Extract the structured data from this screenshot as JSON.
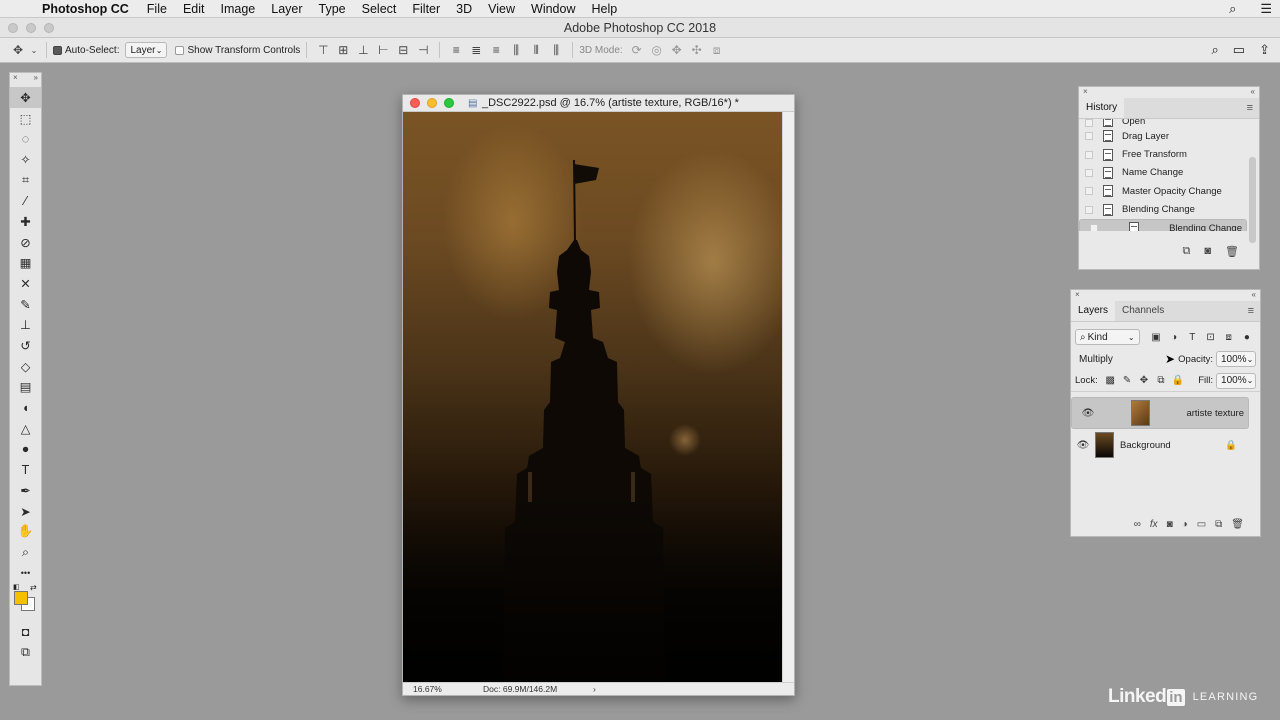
{
  "menubar": {
    "apple": "",
    "app_name": "Photoshop CC",
    "items": [
      "File",
      "Edit",
      "Image",
      "Layer",
      "Type",
      "Select",
      "Filter",
      "3D",
      "View",
      "Window",
      "Help"
    ]
  },
  "window_title": "Adobe Photoshop CC 2018",
  "options_bar": {
    "auto_select_label": "Auto-Select:",
    "auto_select_value": "Layer",
    "transform_label": "Show Transform Controls",
    "mode_label": "3D Mode:"
  },
  "tools": [
    {
      "name": "move-tool",
      "glyph": "✥"
    },
    {
      "name": "marquee-tool",
      "glyph": "⬚"
    },
    {
      "name": "lasso-tool",
      "glyph": "◌"
    },
    {
      "name": "magic-wand-tool",
      "glyph": "✧"
    },
    {
      "name": "crop-tool",
      "glyph": "⌗"
    },
    {
      "name": "eyedropper-tool",
      "glyph": "⁄"
    },
    {
      "name": "spot-healing-tool",
      "glyph": "✚"
    },
    {
      "name": "healing-tool",
      "glyph": "⊘"
    },
    {
      "name": "patch-tool",
      "glyph": "▦"
    },
    {
      "name": "content-aware-move-tool",
      "glyph": "✕"
    },
    {
      "name": "brush-tool",
      "glyph": "✎"
    },
    {
      "name": "clone-stamp-tool",
      "glyph": "⊥"
    },
    {
      "name": "history-brush-tool",
      "glyph": "↺"
    },
    {
      "name": "eraser-tool",
      "glyph": "◇"
    },
    {
      "name": "gradient-tool",
      "glyph": "▤"
    },
    {
      "name": "blur-tool",
      "glyph": "◖"
    },
    {
      "name": "sharpen-tool",
      "glyph": "△"
    },
    {
      "name": "dodge-tool",
      "glyph": "●"
    },
    {
      "name": "type-tool",
      "glyph": "T"
    },
    {
      "name": "pen-tool",
      "glyph": "✒"
    },
    {
      "name": "path-selection-tool",
      "glyph": "➤"
    },
    {
      "name": "hand-tool",
      "glyph": "✋"
    },
    {
      "name": "zoom-tool",
      "glyph": "⌕"
    },
    {
      "name": "more-tools",
      "glyph": "•••"
    }
  ],
  "colors": {
    "foreground": "#f5c000",
    "background": "#ffffff"
  },
  "document": {
    "title": "_DSC2922.psd @ 16.7% (artiste texture, RGB/16*) *",
    "zoom": "16.67%",
    "doc_size": "Doc: 69.9M/146.2M"
  },
  "history": {
    "tab": "History",
    "items": [
      "Open",
      "Drag Layer",
      "Free Transform",
      "Name Change",
      "Master Opacity Change",
      "Blending Change",
      "Blending Change"
    ]
  },
  "layers_panel": {
    "tabs": [
      "Layers",
      "Channels"
    ],
    "kind_label": "Kind",
    "blend_mode": "Multiply",
    "opacity_label": "Opacity:",
    "opacity_value": "100%",
    "lock_label": "Lock:",
    "fill_label": "Fill:",
    "fill_value": "100%",
    "layers": [
      {
        "name": "artiste texture",
        "selected": true
      },
      {
        "name": "Background",
        "selected": false,
        "locked": true
      }
    ]
  },
  "branding": {
    "linked": "Linked",
    "in": "in",
    "learning": "LEARNING"
  }
}
